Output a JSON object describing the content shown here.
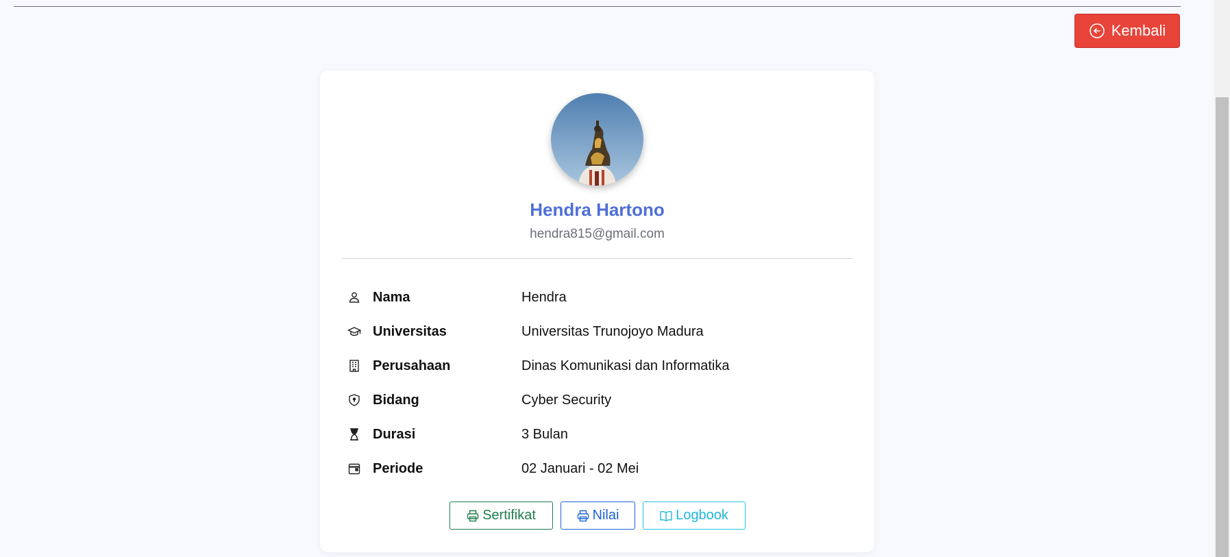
{
  "header": {
    "back_label": "Kembali",
    "back_icon": "arrow-left-circle-icon"
  },
  "profile": {
    "name": "Hendra Hartono",
    "email": "hendra815@gmail.com",
    "avatar": "profile-photo"
  },
  "details": [
    {
      "icon": "person-icon",
      "label": "Nama",
      "value": "Hendra"
    },
    {
      "icon": "graduation-cap-icon",
      "label": "Universitas",
      "value": "Universitas Trunojoyo Madura"
    },
    {
      "icon": "building-icon",
      "label": "Perusahaan",
      "value": "Dinas Komunikasi dan Informatika"
    },
    {
      "icon": "shield-lock-icon",
      "label": "Bidang",
      "value": "Cyber Security"
    },
    {
      "icon": "hourglass-icon",
      "label": "Durasi",
      "value": "3 Bulan"
    },
    {
      "icon": "calendar-icon",
      "label": "Periode",
      "value": "02 Januari - 02 Mei"
    }
  ],
  "actions": {
    "sertifikat_label": "Sertifikat",
    "nilai_label": "Nilai",
    "logbook_label": "Logbook"
  },
  "colors": {
    "back_button": "#e8443a",
    "name": "#4f6fd8",
    "sertifikat": "#1e7d4c",
    "nilai": "#1d63d8",
    "logbook": "#1fb8db"
  }
}
